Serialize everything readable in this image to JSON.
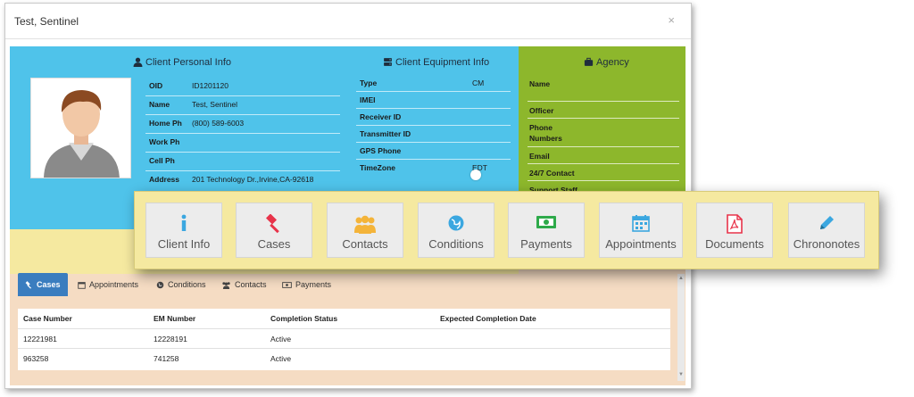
{
  "window": {
    "title": "Test, Sentinel",
    "close_label": "×"
  },
  "client_personal": {
    "title": "Client Personal Info",
    "rows": [
      {
        "label": "OID",
        "value": "ID1201120"
      },
      {
        "label": "Name",
        "value": "Test, Sentinel"
      },
      {
        "label": "Home Ph",
        "value": "(800) 589-6003"
      },
      {
        "label": "Work Ph",
        "value": ""
      },
      {
        "label": "Cell Ph",
        "value": ""
      },
      {
        "label": "Address",
        "value": "201 Technology Dr.,Irvine,CA-92618"
      }
    ]
  },
  "client_equipment": {
    "title": "Client Equipment Info",
    "rows": [
      {
        "label": "Type",
        "value": "CM"
      },
      {
        "label": "IMEI",
        "value": ""
      },
      {
        "label": "Receiver ID",
        "value": ""
      },
      {
        "label": "Transmitter ID",
        "value": ""
      },
      {
        "label": "GPS Phone",
        "value": ""
      },
      {
        "label": "TimeZone",
        "value": "EDT"
      }
    ]
  },
  "agency": {
    "title": "Agency",
    "rows": [
      "Name",
      "Officer",
      "Phone Numbers",
      "Email",
      "24/7 Contact",
      "Support Staff"
    ]
  },
  "tabs": [
    {
      "label": "Cases",
      "icon": "gavel-icon",
      "active": true
    },
    {
      "label": "Appointments",
      "icon": "calendar-icon"
    },
    {
      "label": "Conditions",
      "icon": "globe-icon"
    },
    {
      "label": "Contacts",
      "icon": "users-icon"
    },
    {
      "label": "Payments",
      "icon": "money-icon"
    }
  ],
  "cases_table": {
    "headers": [
      "Case Number",
      "EM Number",
      "Completion Status",
      "Expected Completion Date"
    ],
    "rows": [
      [
        "12221981",
        "12228191",
        "Active",
        ""
      ],
      [
        "963258",
        "741258",
        "Active",
        ""
      ]
    ]
  },
  "quick_menu": [
    {
      "label": "Client Info",
      "icon": "info-icon",
      "color": "#3ba7e0"
    },
    {
      "label": "Cases",
      "icon": "gavel-icon",
      "color": "#e8334a"
    },
    {
      "label": "Contacts",
      "icon": "users-icon",
      "color": "#f4b43a"
    },
    {
      "label": "Conditions",
      "icon": "globe-icon",
      "color": "#3ba7e0"
    },
    {
      "label": "Payments",
      "icon": "money-icon",
      "color": "#2eaa4a"
    },
    {
      "label": "Appointments",
      "icon": "calendar-icon",
      "color": "#3ba7e0"
    },
    {
      "label": "Documents",
      "icon": "pdf-icon",
      "color": "#e8334a"
    },
    {
      "label": "Chrononotes",
      "icon": "pencil-icon",
      "color": "#3ba7e0"
    }
  ],
  "colors": {
    "personal_band": "#4fc3ea",
    "agency_band": "#8db72c",
    "quick_menu_bg": "#f5e9a0",
    "active_tab": "#3a7dbf",
    "body_bg": "#f5dcc3"
  }
}
